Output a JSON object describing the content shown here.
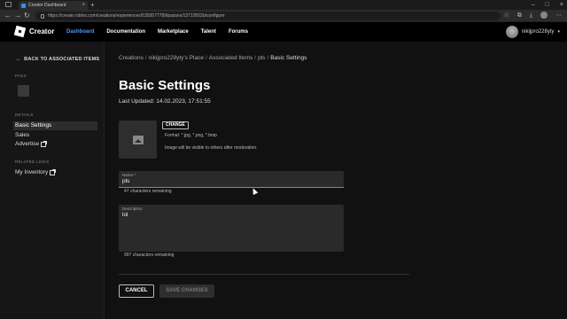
{
  "browser": {
    "tab_title": "Creator Dashboard",
    "tab_close": "×",
    "new_tab": "+",
    "url_host": "create.roblox.com",
    "url_path": "https://create.roblox.com/creations/experiences/5359577789/passes/13710552b/configure",
    "nav": {
      "back": "←",
      "forward": "→",
      "reload": "↻"
    },
    "window_controls": {
      "minimize": "–",
      "maximize": "□",
      "close": "×"
    },
    "toolbar_icons": [
      "star-icon",
      "extensions-icon",
      "downloads-icon",
      "profile-icon",
      "menu-icon"
    ]
  },
  "appbar": {
    "brand": "Creator",
    "nav": [
      {
        "label": "Dashboard",
        "active": true
      },
      {
        "label": "Documentation",
        "active": false
      },
      {
        "label": "Marketplace",
        "active": false
      },
      {
        "label": "Talent",
        "active": false
      },
      {
        "label": "Forums",
        "active": false
      }
    ],
    "username": "nikijpro228yty",
    "accent": "#4a9cf5"
  },
  "sidebar": {
    "back_label": "BACK TO ASSOCIATED ITEMS",
    "pass_heading": "PASS",
    "details_heading": "DETAILS",
    "details": [
      {
        "label": "Basic Settings",
        "active": true,
        "external": false
      },
      {
        "label": "Sales",
        "active": false,
        "external": false
      },
      {
        "label": "Advertise",
        "active": false,
        "external": true
      }
    ],
    "related_heading": "RELATED LINKS",
    "related": [
      {
        "label": "My Inventory",
        "external": true
      }
    ]
  },
  "main": {
    "breadcrumbs": [
      "Creations",
      "nikijpro228yty's Place",
      "Associated Items",
      "pls",
      "Basic Settings"
    ],
    "separator": "/",
    "title": "Basic Settings",
    "last_updated": "Last Updated: 14.02.2023, 17:51:55",
    "change_label": "CHANGE",
    "formats": "Format: *.jpg, *.png, *.bmp",
    "visibility_note": "Image will be visible to others after moderation.",
    "name_field": {
      "label": "Name *",
      "value": "pls",
      "remaining": "47 characters remaining"
    },
    "description_field": {
      "label": "Description",
      "value": "lol",
      "remaining": "997 characters remaining"
    },
    "cancel_label": "CANCEL",
    "save_label": "SAVE CHANGES"
  }
}
